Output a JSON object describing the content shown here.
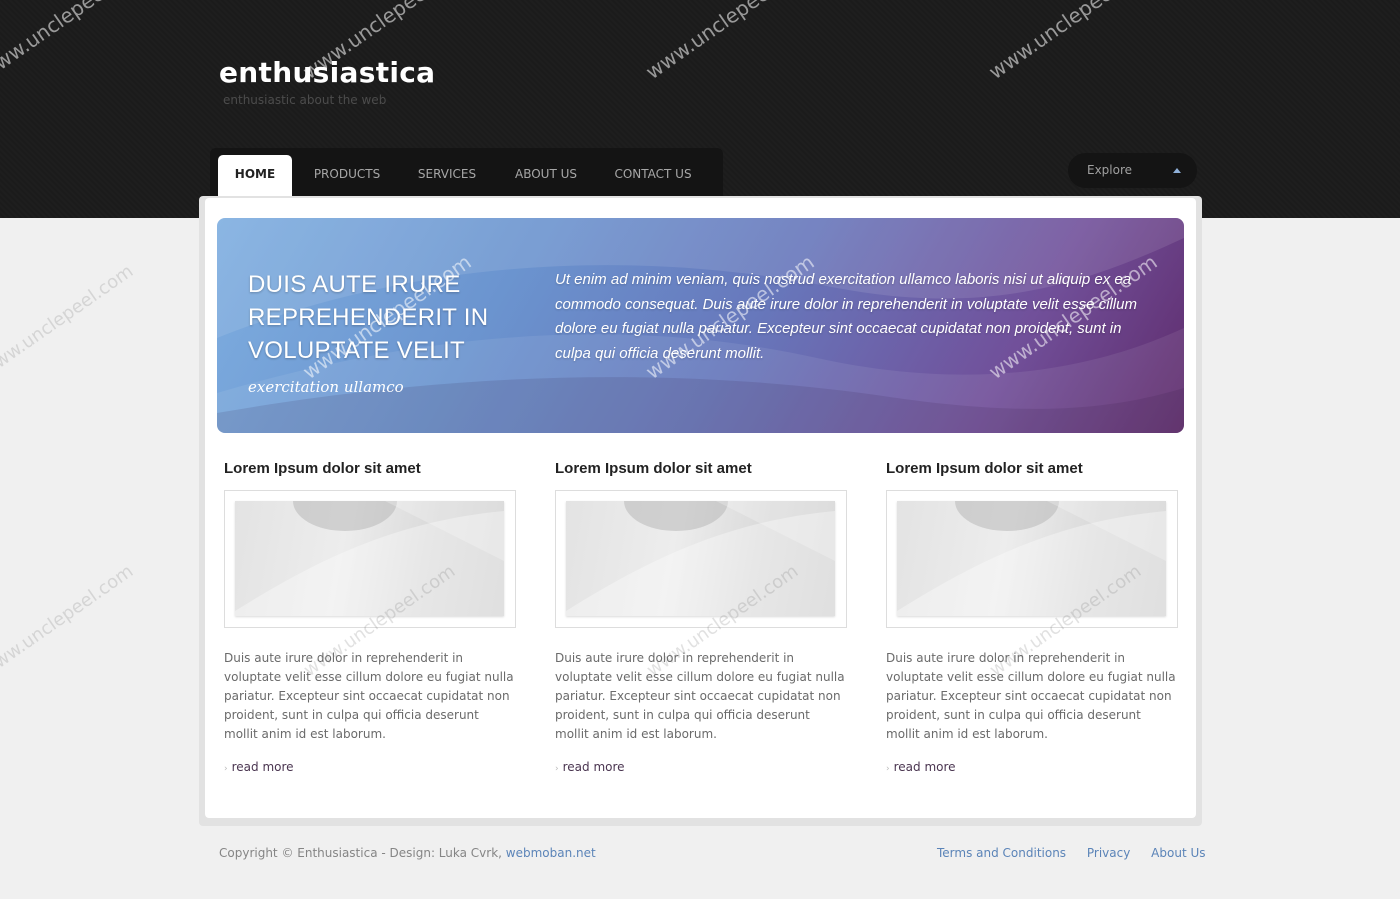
{
  "header": {
    "brand_title": "enthusiastica",
    "brand_tagline": "enthusiastic about the web"
  },
  "nav": {
    "items": [
      {
        "label": "HOME",
        "active": true
      },
      {
        "label": "PRODUCTS",
        "active": false
      },
      {
        "label": "SERVICES",
        "active": false
      },
      {
        "label": "ABOUT US",
        "active": false
      },
      {
        "label": "CONTACT US",
        "active": false
      }
    ],
    "explore_label": "Explore"
  },
  "hero": {
    "heading": "DUIS AUTE IRURE REPREHENDERIT IN VOLUPTATE VELIT",
    "subheading": "exercitation ullamco",
    "text": "Ut enim ad minim veniam, quis nostrud exercitation ullamco laboris nisi ut aliquip ex ea commodo consequat. Duis aute irure dolor in reprehenderit in voluptate velit esse cillum dolore eu fugiat nulla pariatur. Excepteur sint occaecat cupidatat non proident, sunt in culpa qui officia deserunt mollit."
  },
  "columns": [
    {
      "title": "Lorem Ipsum dolor sit amet",
      "text": "Duis aute irure dolor in reprehenderit in voluptate velit esse cillum dolore eu fugiat nulla pariatur. Excepteur sint occaecat cupidatat non proident, sunt in culpa qui officia deserunt mollit anim id est laborum.",
      "read_more": "read more"
    },
    {
      "title": "Lorem Ipsum dolor sit amet",
      "text": "Duis aute irure dolor in reprehenderit in voluptate velit esse cillum dolore eu fugiat nulla pariatur. Excepteur sint occaecat cupidatat non proident, sunt in culpa qui officia deserunt mollit anim id est laborum.",
      "read_more": "read more"
    },
    {
      "title": "Lorem Ipsum dolor sit amet",
      "text": "Duis aute irure dolor in reprehenderit in voluptate velit esse cillum dolore eu fugiat nulla pariatur. Excepteur sint occaecat cupidatat non proident, sunt in culpa qui officia deserunt mollit anim id est laborum.",
      "read_more": "read more"
    }
  ],
  "footer": {
    "copyright": "Copyright © Enthusiastica - Design: Luka Cvrk,",
    "design_link": "webmoban.net",
    "links": [
      "Terms and Conditions",
      "Privacy",
      "About Us"
    ]
  },
  "watermark": "www.unclepeel.com",
  "colors": {
    "header_bg": "#1b1b1b",
    "page_bg": "#f0f0f0",
    "link": "#5b84b8",
    "hero_start": "#7eaee0",
    "hero_end": "#5e2a6a"
  }
}
